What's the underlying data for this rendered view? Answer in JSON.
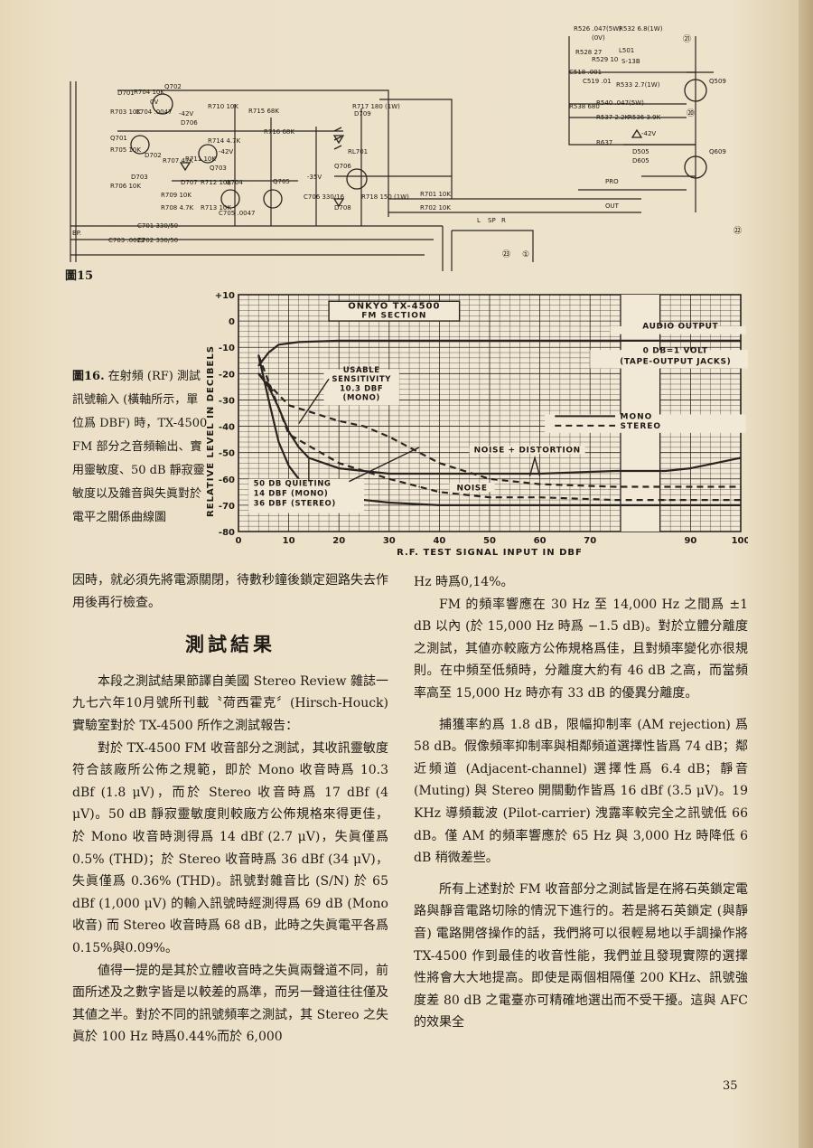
{
  "figure15": {
    "label": "圖15",
    "components": [
      "D701",
      "R704 10K",
      "0V",
      "Q702",
      "R703 10K",
      "C704 .0047",
      "-42V",
      "D706",
      "R710 10K",
      "R715 68K",
      "R716 68K",
      "R717 180 (1W)",
      "D709",
      "Q701",
      "R705 10K",
      "D702",
      "R707 47K",
      "R711 10K",
      "R714 4.7K",
      "-42V",
      "Q703",
      "RL701",
      "-35V",
      "Q706",
      "D703",
      "R706 10K",
      "R709 10K",
      "D707",
      "R712 10K",
      "Q704",
      "Q705",
      "C706 330/16",
      "D708",
      "R718 150 (1W)",
      "R708 4.7K",
      "R713 10K",
      "C705 .0047",
      "C701 330/50",
      "R701 10K",
      "R702 10K",
      "C703 .0022",
      "C702 330/50",
      "BP.",
      "R526 .047(5W)",
      "R532 6.8(1W)",
      "(0V)",
      "L501",
      "R528 27",
      "R529 10",
      "S-13B",
      "C518 .001",
      "C519 .01",
      "R533 2.7(1W)",
      "Q509",
      "R538 680",
      "R540 .047(5W)",
      "R537 2.2K",
      "R536 3.9K",
      "-42V",
      "R637",
      "D505",
      "D605",
      "Q609",
      "PRO",
      "OUT",
      "L",
      "SP",
      "R"
    ],
    "terminals": [
      "㉑",
      "⑳",
      "㉒",
      "㉓",
      "①"
    ]
  },
  "figure16": {
    "label": "圖16.",
    "caption": "在射頻 (RF) 測試訊號輸入 (橫軸所示，單位爲 DBF) 時，TX-4500 FM 部分之音頻輸出、實用靈敏度、50 dB 靜寂靈敏度以及雜音與失眞對於電平之關係曲線圖"
  },
  "chart_data": {
    "type": "line",
    "title": "ONKYO TX-4500",
    "subtitle": "FM SECTION",
    "xlabel": "R.F. TEST SIGNAL INPUT IN DBF",
    "ylabel": "RELATIVE LEVEL IN DECIBELS",
    "xlim": [
      0,
      100
    ],
    "ylim": [
      -80,
      10
    ],
    "x_break": [
      75,
      85
    ],
    "x_ticks": [
      "0",
      "10",
      "20",
      "30",
      "40",
      "50",
      "60",
      "70",
      "90",
      "100"
    ],
    "y_ticks": [
      "+10",
      "0",
      "-10",
      "-20",
      "-30",
      "-40",
      "-50",
      "-60",
      "-70",
      "-80"
    ],
    "grid": true,
    "legend_placement": "right",
    "annotations": {
      "audio_output": "AUDIO OUTPUT",
      "reference": "0 DB=1 VOLT",
      "reference_note": "(TAPE-OUTPUT JACKS)",
      "usable_1": "USABLE",
      "usable_2": "SENSITIVITY",
      "usable_3": "10.3 DBF",
      "usable_4": "(MONO)",
      "noise_distortion": "NOISE + DISTORTION",
      "noise": "NOISE",
      "quieting_1": "50 DB QUIETING",
      "quieting_2": "14 DBF (MONO)",
      "quieting_3": "36 DBF (STEREO)"
    },
    "series": [
      {
        "name": "MONO",
        "style": "solid",
        "curve": "audio output",
        "x": [
          4,
          6,
          8,
          12,
          20,
          40,
          60,
          75,
          85,
          100
        ],
        "y": [
          -17,
          -12,
          -9,
          -8,
          -7.5,
          -7.5,
          -7.5,
          -7.5,
          -7.5,
          -7.5
        ]
      },
      {
        "name": "MONO",
        "style": "solid",
        "curve": "noise + distortion",
        "x": [
          4,
          6,
          8,
          10,
          12,
          14,
          20,
          30,
          40,
          50,
          60,
          75,
          85,
          90,
          100
        ],
        "y": [
          -20,
          -25,
          -33,
          -42,
          -48,
          -52,
          -56,
          -58,
          -58,
          -58,
          -58,
          -57,
          -57,
          -56,
          -52
        ]
      },
      {
        "name": "MONO",
        "style": "solid",
        "curve": "noise",
        "x": [
          4,
          6,
          8,
          10,
          12,
          14,
          20,
          30,
          40,
          50,
          60,
          75,
          85,
          100
        ],
        "y": [
          -13,
          -30,
          -46,
          -55,
          -60,
          -63,
          -67,
          -69,
          -70,
          -70,
          -70,
          -70,
          -70,
          -70
        ]
      },
      {
        "name": "STEREO",
        "style": "dashed",
        "curve": "noise + distortion",
        "x": [
          4,
          10,
          20,
          25,
          30,
          36,
          40,
          50,
          60,
          75,
          85,
          100
        ],
        "y": [
          -20,
          -32,
          -38,
          -40,
          -44,
          -50,
          -54,
          -60,
          -62,
          -63,
          -63,
          -63
        ]
      },
      {
        "name": "STEREO",
        "style": "dashed",
        "curve": "noise",
        "x": [
          4,
          10,
          20,
          30,
          36,
          40,
          50,
          60,
          75,
          85,
          100
        ],
        "y": [
          -13,
          -43,
          -54,
          -60,
          -63,
          -65,
          -67,
          -67,
          -68,
          -68,
          -68
        ]
      }
    ]
  },
  "left_column": {
    "intro_para": "因時，就必須先將電源關閉，待數秒鐘後鎖定廻路失去作用後再行檢查。",
    "heading": "測試結果",
    "paragraphs": [
      "本段之測試結果節譯自美國 Stereo Review 雜誌一九七六年10月號所刊載〝荷西霍克〞(Hirsch-Houck) 實驗室對於 TX-4500 所作之測試報告：",
      "對於 TX-4500 FM 收音部分之測試，其收訊靈敏度符合該廠所公佈之規範，即於 Mono 收音時爲 10.3 dBf (1.8 μV)，而於 Stereo 收音時爲 17 dBf (4 μV)。50 dB 靜寂靈敏度則較廠方公佈規格來得更佳，於 Mono 收音時測得爲 14 dBf (2.7 μV)，失眞僅爲 0.5% (THD)；於 Stereo 收音時爲 36 dBf (34 μV)，失眞僅爲 0.36% (THD)。訊號對雜音比 (S/N) 於 65 dBf (1,000 μV) 的輸入訊號時經測得爲 69 dB (Mono 收音) 而 Stereo 收音時爲 68 dB，此時之失眞電平各爲0.15%與0.09%。",
      "値得一提的是其於立體收音時之失眞兩聲道不同，前面所述及之數字皆是以較差的爲準，而另一聲道往往僅及其値之半。對於不同的訊號頻率之測試，其 Stereo 之失眞於 100 Hz 時爲0.44%而於 6,000"
    ]
  },
  "right_column": {
    "continuation": "Hz 時爲0,14%。",
    "paragraphs": [
      "FM 的頻率響應在 30 Hz 至 14,000 Hz 之間爲 ±1 dB 以內 (於 15,000 Hz 時爲 −1.5 dB)。對於立體分離度之測試，其値亦較廠方公佈規格爲佳，且對頻率變化亦很規則。在中頻至低頻時，分離度大約有 46 dB 之高，而當頻率高至 15,000 Hz 時亦有 33 dB 的優異分離度。",
      "捕獲率約爲 1.8 dB，限幅抑制率 (AM rejection) 爲 58 dB。假像頻率抑制率與相鄰頻道選擇性皆爲 74 dB；鄰近頻道 (Adjacent-channel) 選擇性爲 6.4 dB；靜音 (Muting) 與 Stereo 開關動作皆爲 16 dBf (3.5 μV)。19 KHz 導頻載波 (Pilot-carrier) 洩露率較完全之訊號低 66 dB。僅 AM 的頻率響應於 65 Hz 與 3,000 Hz 時降低 6 dB 稍微差些。",
      "所有上述對於 FM 收音部分之測試皆是在將石英鎖定電路與靜音電路切除的情況下進行的。若是將石英鎖定 (與靜音) 電路開啓操作的話，我們將可以很輕易地以手調操作將 TX-4500 作到最佳的收音性能，我們並且發現實際的選擇性將會大大地提高。即使是兩個相隔僅 200 KHz、訊號強度差 80 dB 之電臺亦可精確地選出而不受干擾。這與 AFC 的效果全"
    ]
  },
  "page_number": "35",
  "colors": {
    "paper": "#ede2ca",
    "ink": "#1f1a15",
    "grid": "#2a2420"
  }
}
